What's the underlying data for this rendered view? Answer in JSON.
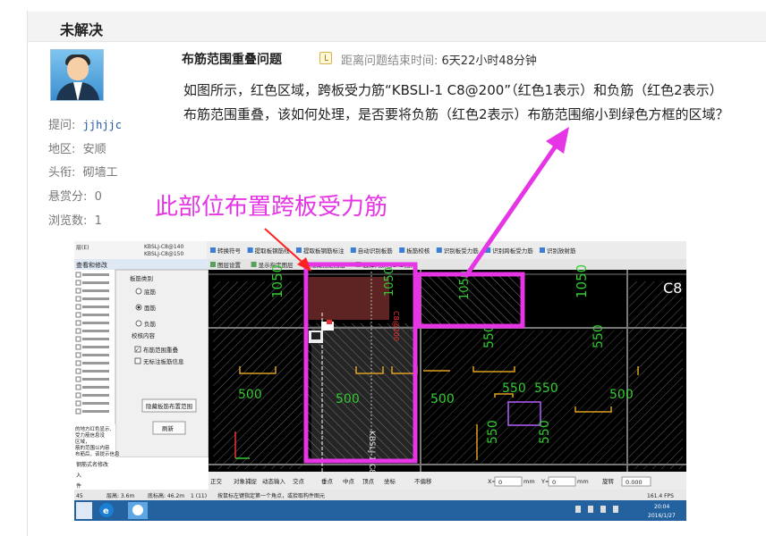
{
  "header": {
    "status": "未解决"
  },
  "asker": {
    "labels": {
      "asker": "提问:",
      "region": "地区:",
      "title": "头衔:",
      "bounty": "悬赏分:",
      "views": "浏览数:"
    },
    "values": {
      "asker": "jjhjjc",
      "region": "安顺",
      "title": "砌墙工",
      "bounty": "0",
      "views": "1"
    }
  },
  "question": {
    "title": "布筋范围重叠问题",
    "deadline_label": "距离问题结束时间:",
    "deadline_value": "6天22小时48分钟",
    "body": "如图所示，红色区域，跨板受力筋“KBSLI-1 C8@200”（红色1表示）和负筋（红色2表示）布筋范围重叠，该如何处理，是否要将负筋（红色2表示）布筋范围缩小到绿色方框的区域？"
  },
  "annotation": {
    "text": "此部位布置跨板受力筋",
    "color": "#e535e5"
  },
  "screenshot": {
    "ribbon": [
      "转换符号",
      "提取板钢筋线",
      "提取板钢筋标注",
      "自动识别板筋",
      "板筋校核",
      "识别板受力筋",
      "识别跨板受力筋",
      "识别放射筋"
    ],
    "layer_bar": [
      "图层设置",
      "显示指定图层",
      "隐藏指定图层",
      "选择同颜色CAD图元"
    ],
    "panel_title": "查看和修改",
    "rebar_type_label": "板筋类别",
    "rebar_types": [
      "底筋",
      "面筋",
      "负筋"
    ],
    "check_label": "校核内容",
    "check_items": [
      "布筋范围重叠",
      "无标注板筋信息"
    ],
    "hide_button": "隐藏板筋布置范围",
    "refresh_button": "刷新",
    "tree_items": [
      "KBSLJ-C8@140",
      "KBSLJ-C8@150"
    ],
    "snap_bar": [
      "正交",
      "对象捕捉",
      "动态输入",
      "交点",
      "垂点",
      "中点",
      "顶点",
      "坐标",
      "不偏移",
      "X=",
      "mm",
      "Y=",
      "mm",
      "旋转"
    ],
    "x_value": "0",
    "y_value": "0",
    "rotate_value": "0.000",
    "status_left": "层高: 3.6m",
    "status_base": "底标高: 46.2m",
    "status_count": "1 (11)",
    "status_hint": "按鼠标左键指定第一个角点，或拾取构件图元",
    "fps": "161.4 FPS",
    "time": "20:04",
    "date": "2016/1/27",
    "left_notes": [
      "的地方红色显示,",
      "受力筋信息没",
      "区域，",
      "筋的范围以内容",
      "布筋后，该提示信息"
    ],
    "left_tree": [
      "钢筋式名修改",
      "入",
      "件"
    ],
    "cad_labels": [
      "1050",
      "1050",
      "1050",
      "1050",
      "550",
      "550",
      "550",
      "550",
      "550",
      "550",
      "500",
      "500",
      "500",
      "500",
      "2200",
      "C8",
      "KBSLJ-1 C8@200",
      "C8@200"
    ]
  }
}
